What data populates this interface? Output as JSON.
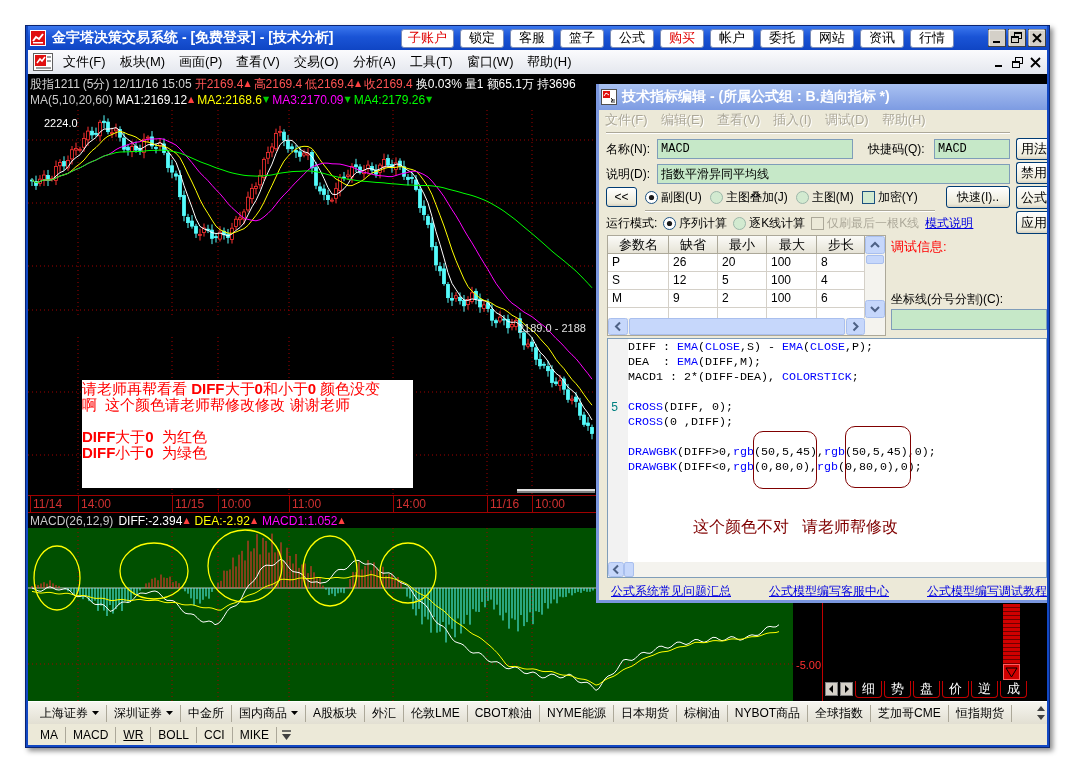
{
  "window": {
    "title": "金宇塔决策交易系统 - [免费登录] - [技术分析]"
  },
  "toolbar": [
    {
      "label": "子账户",
      "highlighted": true
    },
    {
      "label": "锁定",
      "highlighted": false
    },
    {
      "label": "客服",
      "highlighted": false
    },
    {
      "label": "篮子",
      "highlighted": false
    },
    {
      "label": "公式",
      "highlighted": false
    },
    {
      "label": "购买",
      "highlighted": true
    },
    {
      "label": "帐户",
      "highlighted": false
    },
    {
      "label": "委托",
      "highlighted": false
    },
    {
      "label": "网站",
      "highlighted": false
    },
    {
      "label": "资讯",
      "highlighted": false
    },
    {
      "label": "行情",
      "highlighted": false
    }
  ],
  "menu": [
    "文件(F)",
    "板块(M)",
    "画面(P)",
    "查看(V)",
    "交易(O)",
    "分析(A)",
    "工具(T)",
    "窗口(W)",
    "帮助(H)"
  ],
  "quote_bar": [
    {
      "text": "股指1211",
      "color": "#d4d4d4"
    },
    {
      "text": "(5分)",
      "color": "#d4d4d4"
    },
    {
      "text": "12/11/16 15:05",
      "color": "#d4d4d4"
    },
    {
      "text": "开2169.4",
      "color": "#ff5454",
      "arrow": {
        "text": "▲",
        "color": "#ff4040"
      }
    },
    {
      "text": "高2169.4",
      "color": "#ff5454"
    },
    {
      "text": "低2169.4",
      "color": "#ff5454",
      "arrow": {
        "text": "▲",
        "color": "#ff4040"
      }
    },
    {
      "text": "收2169.4",
      "color": "#ff5454"
    },
    {
      "text": "换0.03%",
      "color": "#ffffff"
    },
    {
      "text": "量1",
      "color": "#ffffff"
    },
    {
      "text": "额65.1万",
      "color": "#ffffff"
    },
    {
      "text": "持3696",
      "color": "#ffffff"
    }
  ],
  "ma_bar": {
    "label": "MA(5,10,20,60)",
    "values": [
      {
        "text": "MA1:2169.12",
        "color": "#ffffff",
        "arrow": {
          "text": "▲",
          "color": "#ff4040"
        }
      },
      {
        "text": "MA2:2168.6",
        "color": "#ffff00",
        "arrow": {
          "text": "▼",
          "color": "#00d000"
        }
      },
      {
        "text": "MA3:2170.09",
        "color": "#ff00ff",
        "arrow": {
          "text": "▼",
          "color": "#00d000"
        }
      },
      {
        "text": "MA4:2179.26",
        "color": "#00ff00",
        "arrow": {
          "text": "▼",
          "color": "#00d000"
        }
      }
    ]
  },
  "price_chart": {
    "top_price": "2224.0",
    "cursor_price": "2189.0 - 2188"
  },
  "note": {
    "message": "请老师再帮看看 **DIFF**大于**0**和小于**0** 颜色没变啊  这个颜色请老师帮修改修改 谢谢老师",
    "rules": [
      "**DIFF**大于**0**  为红色",
      "**DIFF**小于**0**  为绿色"
    ]
  },
  "time_axis": [
    "11/14",
    "14:00",
    "11/15",
    "10:00",
    "11:00",
    "14:00",
    "11/16",
    "10:00"
  ],
  "macd_header": [
    {
      "text": "MACD(26,12,9)",
      "color": "#c8c8c8"
    },
    {
      "text": "DIFF:-2.394",
      "color": "#ffffff",
      "arrow": {
        "text": "▲",
        "color": "#ff4040"
      }
    },
    {
      "text": "DEA:-2.92",
      "color": "#ffff00",
      "arrow": {
        "text": "▲",
        "color": "#ff4040"
      }
    },
    {
      "text": "MACD1:1.052",
      "color": "#ff00ff",
      "arrow": {
        "text": "▲",
        "color": "#ff4040"
      }
    }
  ],
  "macd_scale": "-5.00",
  "side_tabs": [
    "细",
    "势",
    "盘",
    "价",
    "逆",
    "成"
  ],
  "market_tabs": [
    {
      "label": "上海证券",
      "dropdown": true
    },
    {
      "label": "深圳证券",
      "dropdown": true
    },
    {
      "label": "中金所",
      "dropdown": false
    },
    {
      "label": "国内商品",
      "dropdown": true
    },
    {
      "label": "A股板块",
      "dropdown": false
    },
    {
      "label": "外汇",
      "dropdown": false
    },
    {
      "label": "伦敦LME",
      "dropdown": false
    },
    {
      "label": "CBOT粮油",
      "dropdown": false
    },
    {
      "label": "NYME能源",
      "dropdown": false
    },
    {
      "label": "日本期货",
      "dropdown": false
    },
    {
      "label": "棕榈油",
      "dropdown": false
    },
    {
      "label": "NYBOT商品",
      "dropdown": false
    },
    {
      "label": "全球指数",
      "dropdown": false
    },
    {
      "label": "芝加哥CME",
      "dropdown": false
    },
    {
      "label": "恒指期货",
      "dropdown": false
    }
  ],
  "indicator_tabs": [
    {
      "label": "MA",
      "hovered": false
    },
    {
      "label": "MACD",
      "hovered": false
    },
    {
      "label": "WR",
      "hovered": true
    },
    {
      "label": "BOLL",
      "hovered": false
    },
    {
      "label": "CCI",
      "hovered": false
    },
    {
      "label": "MIKE",
      "hovered": false
    }
  ],
  "dialog": {
    "title": "技术指标编辑 - (所属公式组 : B.趋向指标 *)",
    "menu": [
      {
        "label": "文件(F)",
        "disabled": true
      },
      {
        "label": "编辑(E)",
        "disabled": true
      },
      {
        "label": "查看(V)",
        "disabled": true
      },
      {
        "label": "插入(I)",
        "disabled": true
      },
      {
        "label": "调试(D)",
        "disabled": true
      },
      {
        "label": "帮助(H)",
        "disabled": true
      }
    ],
    "name_label": "名称(N):",
    "name": "MACD",
    "shortcut_label": "快捷码(Q):",
    "shortcut": "MACD",
    "description_label": "说明(D):",
    "description": "指数平滑异同平均线",
    "side_buttons": [
      "用法",
      "禁用",
      "公式",
      "应用"
    ],
    "collapse_button": "<<",
    "chart_types": [
      {
        "label": "副图(U)",
        "selected": true
      },
      {
        "label": "主图叠加(J)",
        "selected": false
      },
      {
        "label": "主图(M)",
        "selected": false
      }
    ],
    "encrypt": {
      "label": "加密(Y)",
      "checked": false
    },
    "quick_button": "快速(I)..",
    "run_mode_label": "运行模式:",
    "run_modes": [
      {
        "label": "序列计算",
        "selected": true
      },
      {
        "label": "逐K线计算",
        "selected": false
      }
    ],
    "refresh_last": {
      "label": "仅刷最后一根K线",
      "checked": false,
      "disabled": true
    },
    "mode_help_link": "模式说明",
    "params": {
      "columns": [
        "参数名",
        "缺省",
        "最小",
        "最大",
        "步长"
      ],
      "rows": [
        [
          "P",
          "26",
          "20",
          "100",
          "8"
        ],
        [
          "S",
          "12",
          "5",
          "100",
          "4"
        ],
        [
          "M",
          "9",
          "2",
          "100",
          "6"
        ]
      ]
    },
    "debug_label": "调试信息:",
    "axis_label": "坐标线(分号分割)(C):",
    "code_lines": [
      {
        "kind": "code",
        "tokens": [
          {
            "kind": "text",
            "text": "DIFF : "
          },
          {
            "kind": "keyword",
            "text": "EMA"
          },
          {
            "kind": "text",
            "text": "("
          },
          {
            "kind": "keyword",
            "text": "CLOSE"
          },
          {
            "kind": "text",
            "text": ",S) - "
          },
          {
            "kind": "keyword",
            "text": "EMA"
          },
          {
            "kind": "text",
            "text": "("
          },
          {
            "kind": "keyword",
            "text": "CLOSE"
          },
          {
            "kind": "text",
            "text": ",P);"
          }
        ]
      },
      {
        "kind": "code",
        "tokens": [
          {
            "kind": "text",
            "text": "DEA  : "
          },
          {
            "kind": "keyword",
            "text": "EMA"
          },
          {
            "kind": "text",
            "text": "(DIFF,M);"
          }
        ]
      },
      {
        "kind": "code",
        "tokens": [
          {
            "kind": "text",
            "text": "MACD1 : 2*(DIFF-DEA), "
          },
          {
            "kind": "keyword",
            "text": "COLORSTICK"
          },
          {
            "kind": "text",
            "text": ";"
          }
        ]
      },
      {
        "kind": "blank"
      },
      {
        "kind": "code",
        "line_number": "5",
        "tokens": [
          {
            "kind": "keyword",
            "text": "CROSS"
          },
          {
            "kind": "text",
            "text": "(DIFF, 0);"
          }
        ]
      },
      {
        "kind": "code",
        "tokens": [
          {
            "kind": "keyword",
            "text": "CROSS"
          },
          {
            "kind": "text",
            "text": "(0 ,DIFF);"
          }
        ]
      },
      {
        "kind": "blank"
      },
      {
        "kind": "code",
        "tokens": [
          {
            "kind": "keyword",
            "text": "DRAWGBK"
          },
          {
            "kind": "text",
            "text": "(DIFF>0,"
          },
          {
            "kind": "keyword",
            "text": "rgb"
          },
          {
            "kind": "text",
            "text": "(50,5,45),"
          },
          {
            "kind": "keyword",
            "text": "rgb"
          },
          {
            "kind": "text",
            "text": "(50,5,45),0);"
          }
        ]
      },
      {
        "kind": "code",
        "tokens": [
          {
            "kind": "keyword",
            "text": "DRAWGBK"
          },
          {
            "kind": "text",
            "text": "(DIFF<0,"
          },
          {
            "kind": "keyword",
            "text": "rgb"
          },
          {
            "kind": "text",
            "text": "(0,80,0),"
          },
          {
            "kind": "keyword",
            "text": "rgb"
          },
          {
            "kind": "text",
            "text": "(0,80,0),0);"
          }
        ]
      }
    ],
    "annotation": "这个颜色不对   请老师帮修改",
    "links": [
      "公式系统常见问题汇总",
      "公式模型编写客服中心",
      "公式模型编写调试教程"
    ]
  }
}
